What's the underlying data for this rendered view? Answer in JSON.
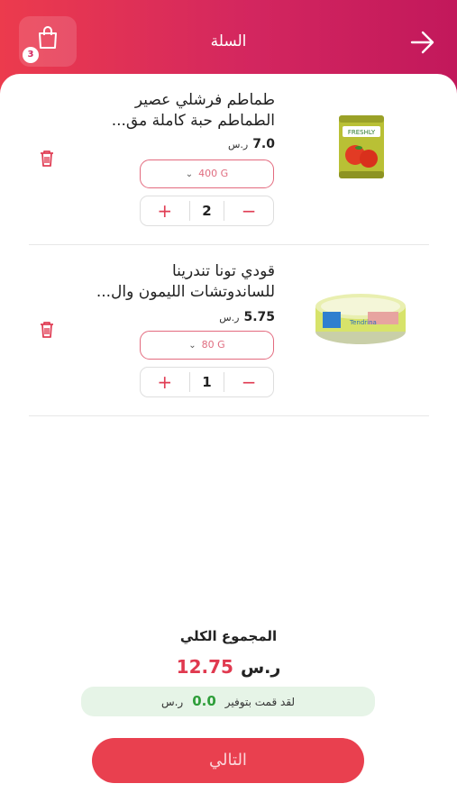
{
  "header": {
    "title": "السلة",
    "cart_count": "3",
    "gradient_start": "#ec3b4d",
    "gradient_end": "#c2185b"
  },
  "items": [
    {
      "name_line1": "طماطم فرشلي عصير",
      "name_line2": "الطماطم حبة كاملة مق...",
      "price": "7.0",
      "currency": "ر.س",
      "size": "400 G",
      "quantity": "2",
      "image": "tomato-can"
    },
    {
      "name_line1": "قودي تونا تندرينا",
      "name_line2": "للساندوتشات الليمون وال...",
      "price": "5.75",
      "currency": "ر.س",
      "size": "80 G",
      "quantity": "1",
      "image": "tuna-can"
    }
  ],
  "summary": {
    "total_label": "المجموع الكلي",
    "total_amount": "12.75",
    "total_currency": "ر.س",
    "savings_label": "لقد قمت بتوفير",
    "savings_amount": "0.0",
    "savings_currency": "ر.س"
  },
  "footer": {
    "next_label": "التالي"
  },
  "colors": {
    "accent": "#e9404f",
    "savings_bg": "#e6f4e7",
    "savings_text": "#2e9e3a"
  }
}
